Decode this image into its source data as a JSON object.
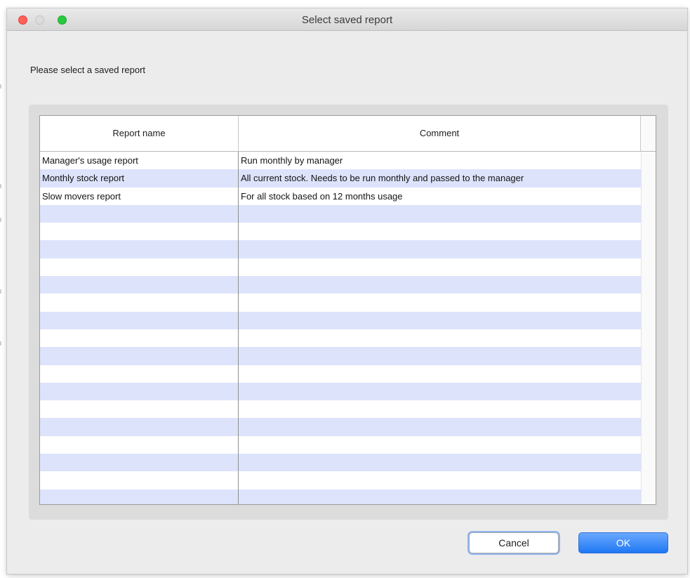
{
  "window": {
    "title": "Select saved report"
  },
  "prompt": "Please select a saved report",
  "table": {
    "columns": [
      "Report name",
      "Comment"
    ],
    "rows": [
      {
        "name": "Manager's usage report",
        "comment": "Run monthly by manager"
      },
      {
        "name": "Monthly stock report",
        "comment": "All current stock. Needs to be run monthly and passed to the manager"
      },
      {
        "name": "Slow movers report",
        "comment": "For all stock based on 12 months usage"
      }
    ],
    "empty_rows": 17
  },
  "buttons": {
    "cancel": "Cancel",
    "ok": "OK"
  },
  "colors": {
    "row_stripe": "#dde3fb",
    "ok_button": "#1f78f3",
    "focus_ring": "#8fb4ef"
  }
}
